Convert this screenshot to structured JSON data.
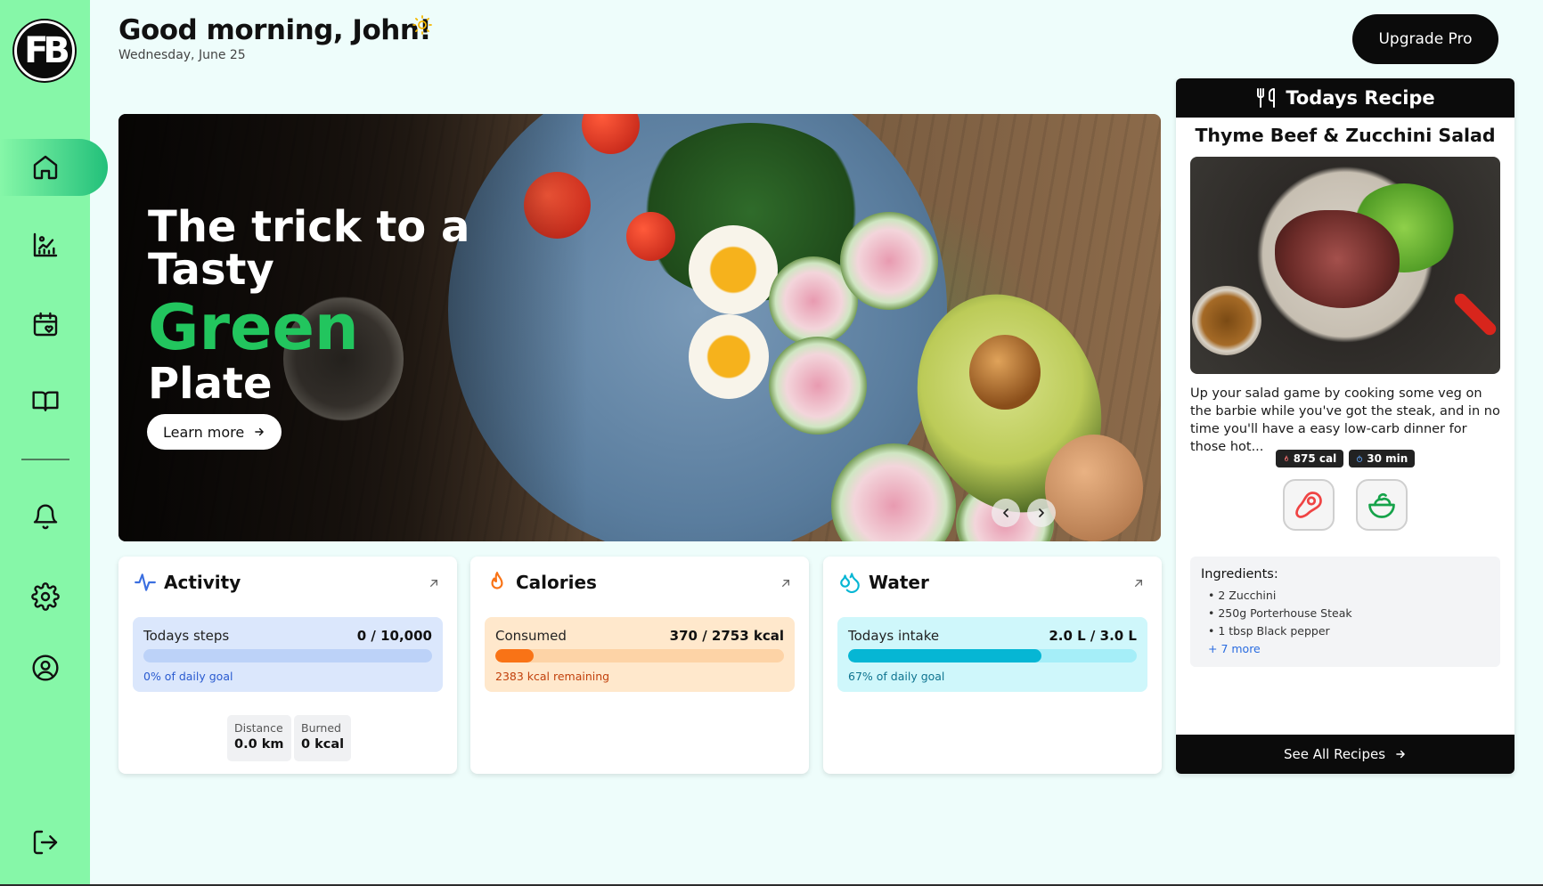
{
  "app": {
    "logo_text": "FB"
  },
  "header": {
    "greeting": "Good morning, John!",
    "date": "Wednesday, June 25",
    "upgrade_label": "Upgrade Pro"
  },
  "sidebar": {
    "items": [
      {
        "name": "home",
        "icon": "home-icon",
        "active": true
      },
      {
        "name": "progress",
        "icon": "chart-icon"
      },
      {
        "name": "calendar",
        "icon": "calendar-heart-icon"
      },
      {
        "name": "recipes",
        "icon": "book-icon"
      },
      {
        "name": "notifications",
        "icon": "bell-icon"
      },
      {
        "name": "settings",
        "icon": "gear-icon"
      },
      {
        "name": "profile",
        "icon": "user-circle-icon"
      },
      {
        "name": "logout",
        "icon": "logout-icon"
      }
    ]
  },
  "hero": {
    "line1": "The trick to a",
    "line2": "Tasty",
    "line3": "Green",
    "line4": "Plate",
    "cta": "Learn more",
    "accent": "#22c55e"
  },
  "activity": {
    "title": "Activity",
    "label": "Todays steps",
    "value": "0 / 10,000",
    "progress": 0,
    "sub": "0% of daily goal",
    "distance_label": "Distance",
    "distance_value": "0.0 km",
    "burned_label": "Burned",
    "burned_value": "0 kcal",
    "color": "#3b6fe0"
  },
  "calories": {
    "title": "Calories",
    "label": "Consumed",
    "value": "370 / 2753 kcal",
    "progress": 0.134,
    "sub": "2383 kcal remaining",
    "color": "#f97316"
  },
  "water": {
    "title": "Water",
    "label": "Todays intake",
    "value": "2.0 L / 3.0 L",
    "progress": 0.67,
    "sub": "67% of daily goal",
    "color": "#06b6d4"
  },
  "recipe": {
    "header": "Todays Recipe",
    "name": "Thyme Beef & Zucchini Salad",
    "description": "Up your salad game by cooking some veg on the barbie while you've got the steak, and in no time you'll have a easy low-carb dinner for those hot...",
    "calories": "875 cal",
    "time": "30 min",
    "tags": [
      "meat-icon",
      "salad-icon"
    ],
    "ingredients_title": "Ingredients:",
    "ingredients": [
      "• 2 Zucchini",
      "• 250g Porterhouse Steak",
      "• 1 tbsp Black pepper"
    ],
    "more": "+ 7 more",
    "see_all": "See All Recipes"
  }
}
